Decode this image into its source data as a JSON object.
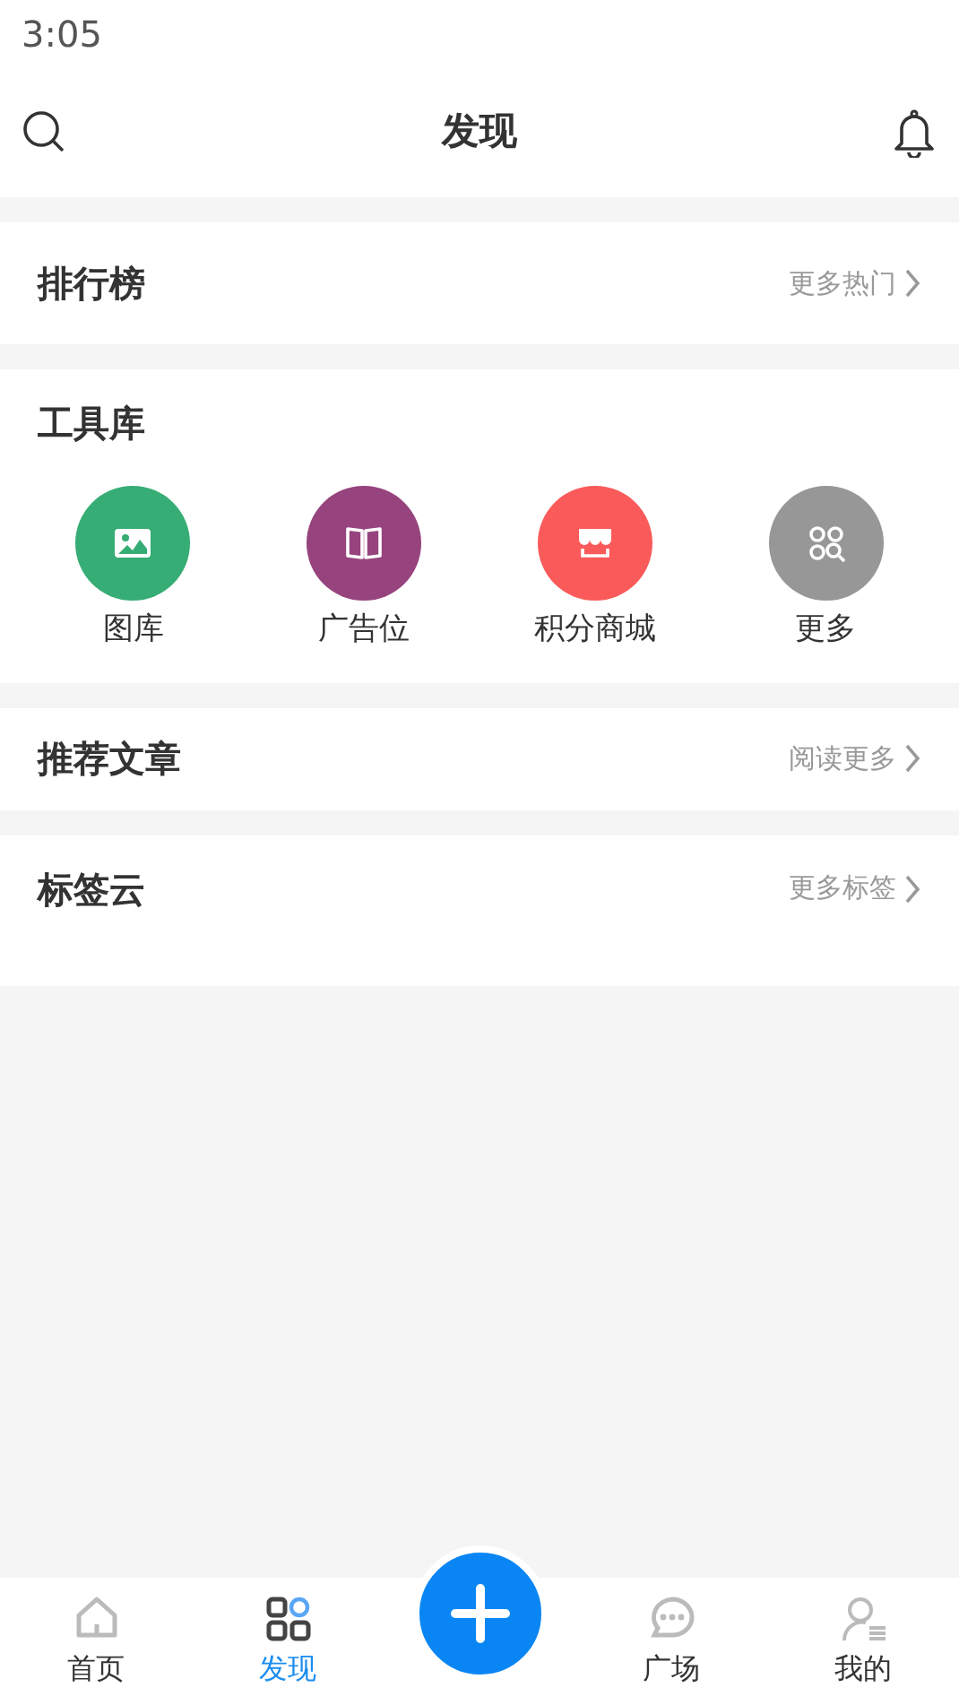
{
  "status_bar": {
    "time": "3:05"
  },
  "header": {
    "title": "发现"
  },
  "sections": [
    {
      "kind": "link",
      "title": "排行榜",
      "more": "更多热门"
    },
    {
      "kind": "tools",
      "title": "工具库",
      "tools": [
        {
          "label": "图库",
          "color": "#36ad74"
        },
        {
          "label": "广告位",
          "color": "#96437e"
        },
        {
          "label": "积分商城",
          "color": "#fa5a5a"
        },
        {
          "label": "更多",
          "color": "#979797"
        }
      ]
    },
    {
      "kind": "link",
      "title": "推荐文章",
      "more": "阅读更多"
    },
    {
      "kind": "tags",
      "title": "标签云",
      "more": "更多标签"
    }
  ],
  "tab_bar": [
    {
      "kind": "tab",
      "label": "首页",
      "selected": false
    },
    {
      "kind": "tab",
      "label": "发现",
      "selected": true
    },
    {
      "kind": "plus"
    },
    {
      "kind": "tab",
      "label": "广场",
      "selected": false
    },
    {
      "kind": "tab",
      "label": "我的",
      "selected": false
    }
  ]
}
